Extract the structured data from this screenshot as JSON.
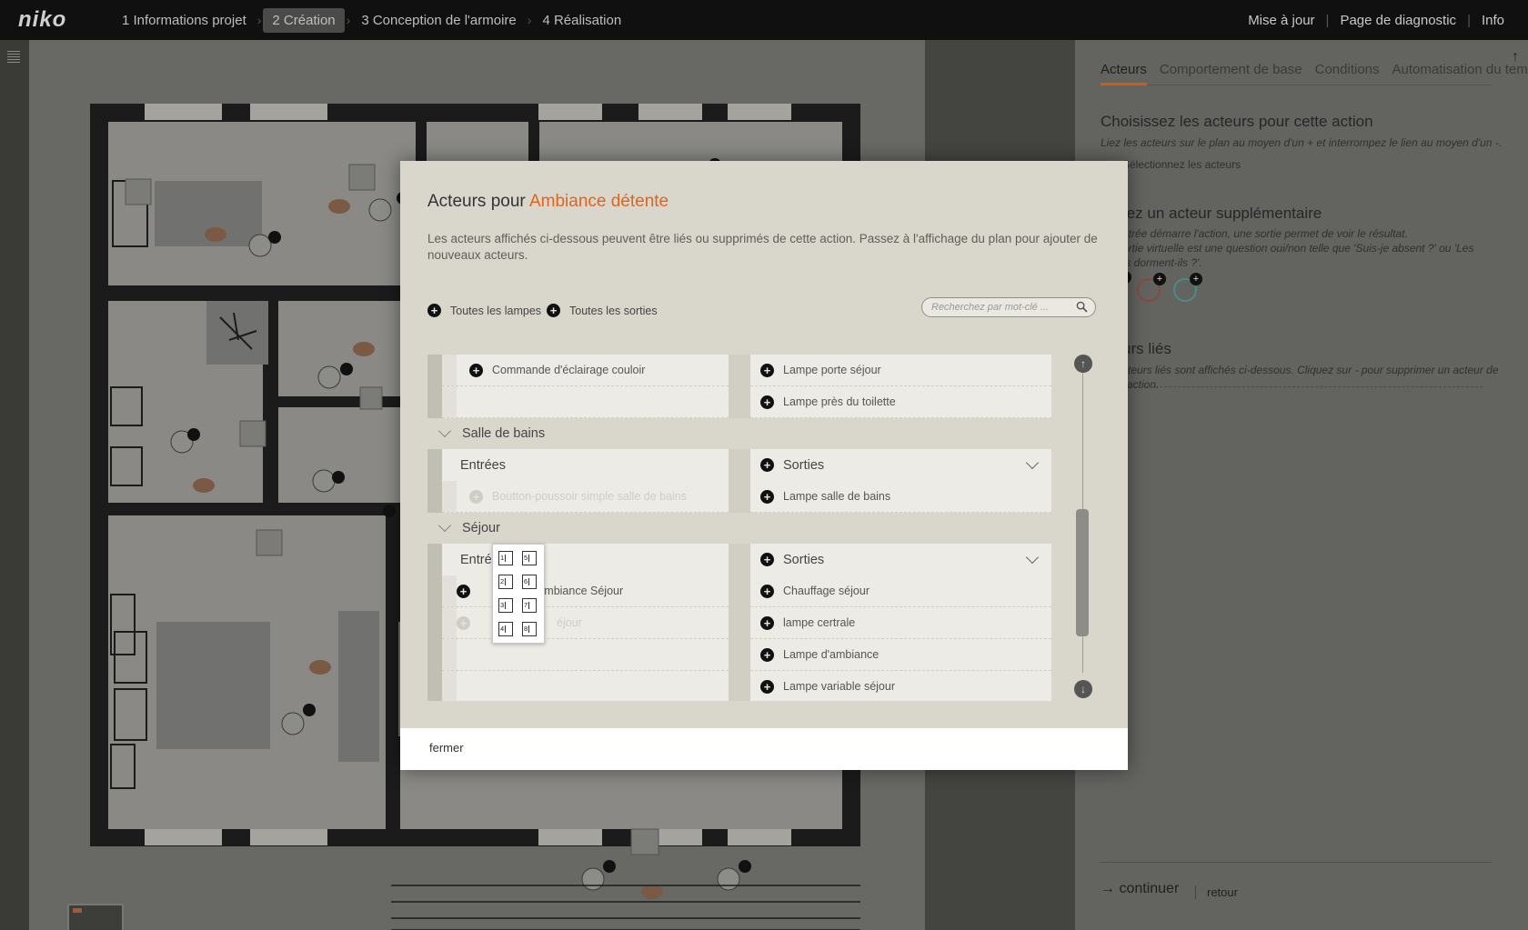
{
  "topbar": {
    "logo": "niko",
    "steps": [
      "1 Informations projet",
      "2 Création",
      "3 Conception de l'armoire",
      "4 Réalisation"
    ],
    "active_step": 1,
    "links": [
      "Mise à jour",
      "Page de diagnostic",
      "Info"
    ]
  },
  "rightpanel": {
    "tabs": [
      "Acteurs",
      "Comportement de base",
      "Conditions",
      "Automatisation du temps"
    ],
    "heading1": "Choisissez les acteurs pour cette action",
    "text1": "Liez les acteurs sur le plan au moyen d'un + et interrompez le lien au moyen d'un -.",
    "text1b": "Sélectionnez les acteurs",
    "heading2": "tez un acteur supplémentaire",
    "text2": "ntrée démarre l'action, une sortie permet de voir le résultat.",
    "text2b": "ortie virtuelle est une question oui/non telle que 'Suis-je absent ?' ou 'Les",
    "text2c": "ts dorment-ils ?'.",
    "heading3": "urs liés",
    "text3": "cteurs liés sont affichés ci-dessous. Cliquez sur - pour supprimer un acteur de l'action.",
    "continue": "continuer",
    "back": "retour"
  },
  "dialog": {
    "title_prefix": "Acteurs pour",
    "title_highlight": "Ambiance détente",
    "accent_color": "#e0641e",
    "description": "Les acteurs affichés ci-dessous peuvent être liés ou supprimés de cette action. Passez à l'affichage du plan pour ajouter de nouveaux acteurs.",
    "all_lamps": "Toutes les lampes",
    "all_outputs": "Toutes les sorties",
    "search_placeholder": "Recherchez par mot-clé ...",
    "close": "fermer",
    "list": {
      "r0_left": "Commande d'éclairage couloir",
      "r0_right": "Lampe porte séjour",
      "r1_right": "Lampe près du toilette",
      "sec1": "Salle de bains",
      "sec1_inputs": "Entrées",
      "sec1_outputs": "Sorties",
      "sec1_r0_left": "Boutton-poussoir simple salle de bains",
      "sec1_r0_right": "Lampe salle de bains",
      "sec2": "Séjour",
      "sec2_inputs": "Entré",
      "sec2_outputs": "Sorties",
      "sec2_r0_left": "d'ambiance Séjour",
      "sec2_r0_right": "Chauffage séjour",
      "sec2_r1_left": "éjour",
      "sec2_r1_right": "lampe certrale",
      "sec2_r2_right": "Lampe d'ambiance",
      "sec2_r3_right": "Lampe variable séjour"
    },
    "popup": [
      "1",
      "5",
      "2",
      "6",
      "3",
      "7",
      "4",
      "8"
    ]
  }
}
